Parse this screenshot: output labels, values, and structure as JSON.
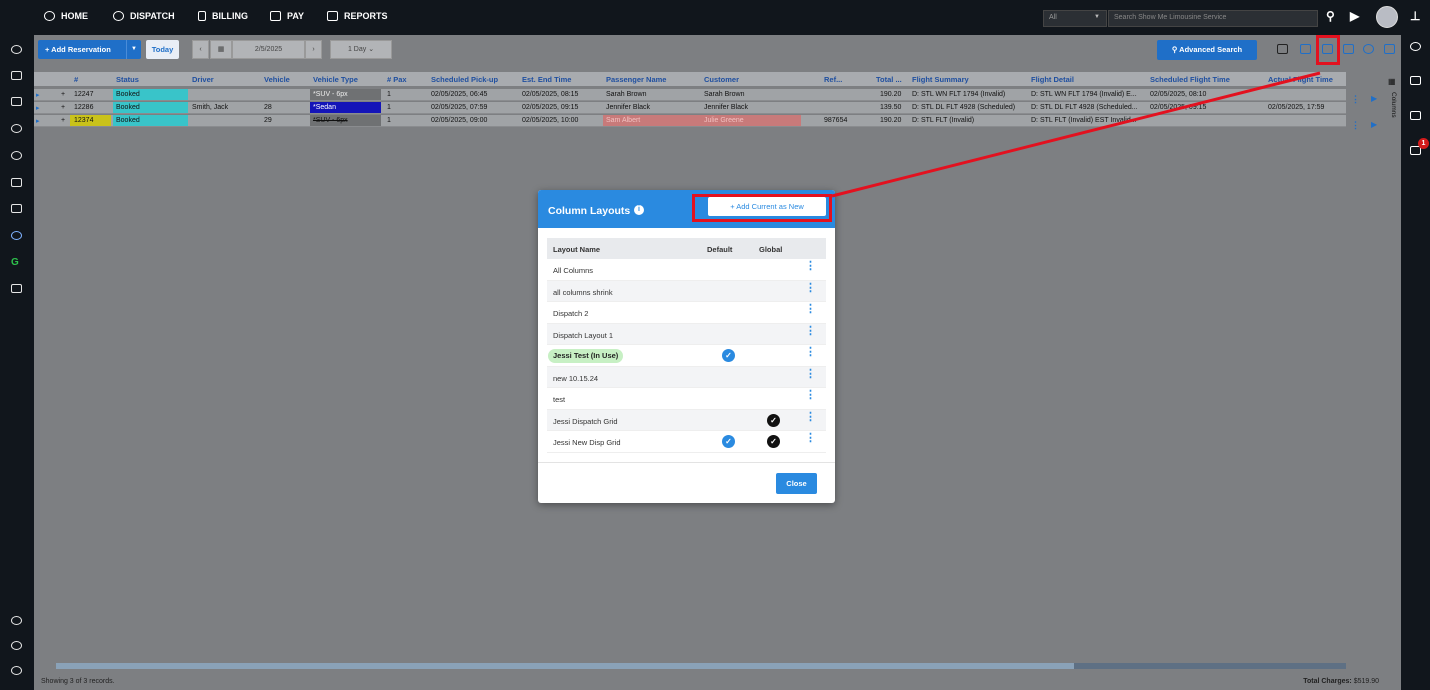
{
  "nav": {
    "items": [
      {
        "label": "HOME",
        "icon": "home-icon"
      },
      {
        "label": "DISPATCH",
        "icon": "dispatch-icon"
      },
      {
        "label": "BILLING",
        "icon": "billing-icon"
      },
      {
        "label": "PAY",
        "icon": "pay-icon"
      },
      {
        "label": "REPORTS",
        "icon": "reports-icon"
      }
    ],
    "search_scope": "All",
    "search_placeholder": "Search Show Me Limousine Service"
  },
  "toolbar": {
    "add_label": "+ Add Reservation",
    "today_label": "Today",
    "date": "2/5/2025",
    "range": "1 Day",
    "advanced_search": "Advanced Search"
  },
  "grid": {
    "columns": [
      "#",
      "Status",
      "Driver",
      "Vehicle",
      "Vehicle Type",
      "# Pax",
      "Scheduled Pick-up",
      "Est. End Time",
      "Passenger Name",
      "Customer",
      "Ref...",
      "Total ...",
      "Flight Summary",
      "Flight Detail",
      "Scheduled Flight Time",
      "Actual Flight Time"
    ],
    "rows": [
      {
        "id": "12247",
        "status": "Booked",
        "driver": "",
        "vehicle": "",
        "vehicle_type": "*SUV - 6px",
        "pax": "1",
        "pickup": "02/05/2025, 06:45",
        "end": "02/05/2025, 08:15",
        "passenger": "Sarah Brown",
        "customer": "Sarah Brown",
        "ref": "",
        "total": "190.20",
        "flight_summary": "D: STL WN FLT 1794 (Invalid)",
        "flight_detail": "D: STL WN FLT 1794 (Invalid) E...",
        "sched_flight": "02/05/2025, 08:10",
        "actual_flight": ""
      },
      {
        "id": "12286",
        "status": "Booked",
        "driver": "Smith, Jack",
        "vehicle": "28",
        "vehicle_type": "*Sedan",
        "pax": "1",
        "pickup": "02/05/2025, 07:59",
        "end": "02/05/2025, 09:15",
        "passenger": "Jennifer Black",
        "customer": "Jennifer Black",
        "ref": "",
        "total": "139.50",
        "flight_summary": "D: STL DL FLT 4928 (Scheduled)",
        "flight_detail": "D: STL DL FLT 4928 (Scheduled...",
        "sched_flight": "02/05/2025, 09:15",
        "actual_flight": "02/05/2025, 17:59"
      },
      {
        "id": "12374",
        "status": "Booked",
        "driver": "",
        "vehicle": "29",
        "vehicle_type": "*SUV - 6px",
        "pax": "1",
        "pickup": "02/05/2025, 09:00",
        "end": "02/05/2025, 10:00",
        "passenger": "Sam Albert",
        "customer": "Julie Greene",
        "ref": "987654",
        "total": "190.20",
        "flight_summary": "D: STL FLT (Invalid)",
        "flight_detail": "D: STL FLT (Invalid) EST Invalid...",
        "sched_flight": "",
        "actual_flight": ""
      }
    ],
    "side_tab": "Columns",
    "footer_records": "Showing 3 of 3 records.",
    "footer_total_label": "Total Charges:",
    "footer_total_value": "$519.90"
  },
  "modal": {
    "title": "Column Layouts",
    "add_button": "+ Add Current as New",
    "headers": {
      "name": "Layout Name",
      "default": "Default",
      "global": "Global"
    },
    "layouts": [
      {
        "name": "All Columns",
        "default": false,
        "global": false,
        "in_use": false
      },
      {
        "name": "all columns shrink",
        "default": false,
        "global": false,
        "in_use": false
      },
      {
        "name": "Dispatch 2",
        "default": false,
        "global": false,
        "in_use": false
      },
      {
        "name": "Dispatch Layout 1",
        "default": false,
        "global": false,
        "in_use": false
      },
      {
        "name": "Jessi Test (In Use)",
        "default": true,
        "global": false,
        "in_use": true
      },
      {
        "name": "new 10.15.24",
        "default": false,
        "global": false,
        "in_use": false
      },
      {
        "name": "test",
        "default": false,
        "global": false,
        "in_use": false
      },
      {
        "name": "Jessi Dispatch Grid",
        "default": false,
        "global": true,
        "in_use": false
      },
      {
        "name": "Jessi New Disp Grid",
        "default": true,
        "global": true,
        "in_use": false
      }
    ],
    "close_label": "Close"
  },
  "right_sidebar": {
    "badge": "1"
  },
  "colors": {
    "accent": "#2a8ae0",
    "highlight": "#e3111f",
    "status_booked": "#39c4c9",
    "in_use": "#c7f0c4"
  }
}
